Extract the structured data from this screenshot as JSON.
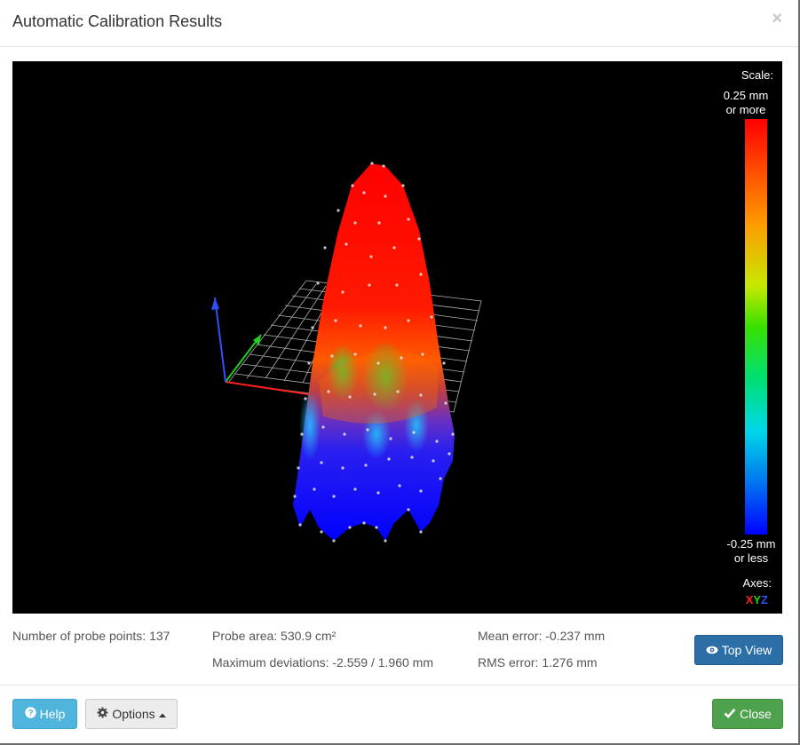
{
  "dialog": {
    "title": "Automatic Calibration Results",
    "close_symbol": "×"
  },
  "viewer": {
    "scale_title": "Scale:",
    "scale_max_line1": "0.25 mm",
    "scale_max_line2": "or more",
    "scale_min_line1": "-0.25 mm",
    "scale_min_line2": "or less",
    "axes_title": "Axes:",
    "axis_x": "X",
    "axis_y": "Y",
    "axis_z": "Z",
    "scale_colors": [
      "#ff0000",
      "#ff9900",
      "#c8e800",
      "#39e000",
      "#00d8e8",
      "#0000ff"
    ]
  },
  "stats": {
    "probe_points": "Number of probe points: 137",
    "probe_area": "Probe area: 530.9 cm²",
    "max_deviations": "Maximum deviations: -2.559 / 1.960 mm",
    "mean_error": "Mean error: -0.237 mm",
    "rms_error": "RMS error: 1.276 mm"
  },
  "buttons": {
    "top_view": "Top View",
    "help": "Help",
    "options": "Options",
    "close": "Close"
  },
  "icons": {
    "top_view": "eye-icon",
    "help": "question-circle-icon",
    "options": "gear-icon",
    "options_caret": "caret-up-icon",
    "close": "check-icon"
  }
}
